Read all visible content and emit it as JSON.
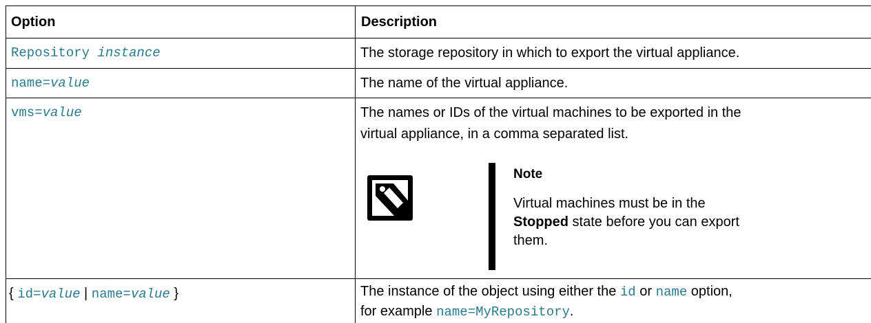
{
  "header": {
    "option": "Option",
    "description": "Description"
  },
  "rows": [
    {
      "option_code": "Repository ",
      "option_var": "instance",
      "description": "The storage repository in which to export the virtual appliance."
    },
    {
      "option_code": "name=",
      "option_var": "value",
      "description": "The name of the virtual appliance."
    },
    {
      "option_code": "vms=",
      "option_var": "value",
      "description_line1": "The names or IDs of the virtual machines to be exported in the",
      "description_line2": "virtual appliance, in a comma separated list.",
      "note": {
        "title": "Note",
        "body_1": "Virtual machines must be in the",
        "body_bold": "Stopped",
        "body_2": " state before you can export them.",
        "icon": "note-tag-icon"
      }
    },
    {
      "brace_open": "{ ",
      "id_code": "id=",
      "id_var": "value",
      "sep": " | ",
      "name_code": "name=",
      "name_var": "value",
      "brace_close": " }",
      "desc_a": "The instance of the object using either the ",
      "desc_id": "id",
      "desc_b": " or ",
      "desc_name": "name",
      "desc_c": " option,",
      "desc_d": "for example ",
      "desc_example": "name=MyRepository",
      "desc_e": "."
    }
  ]
}
